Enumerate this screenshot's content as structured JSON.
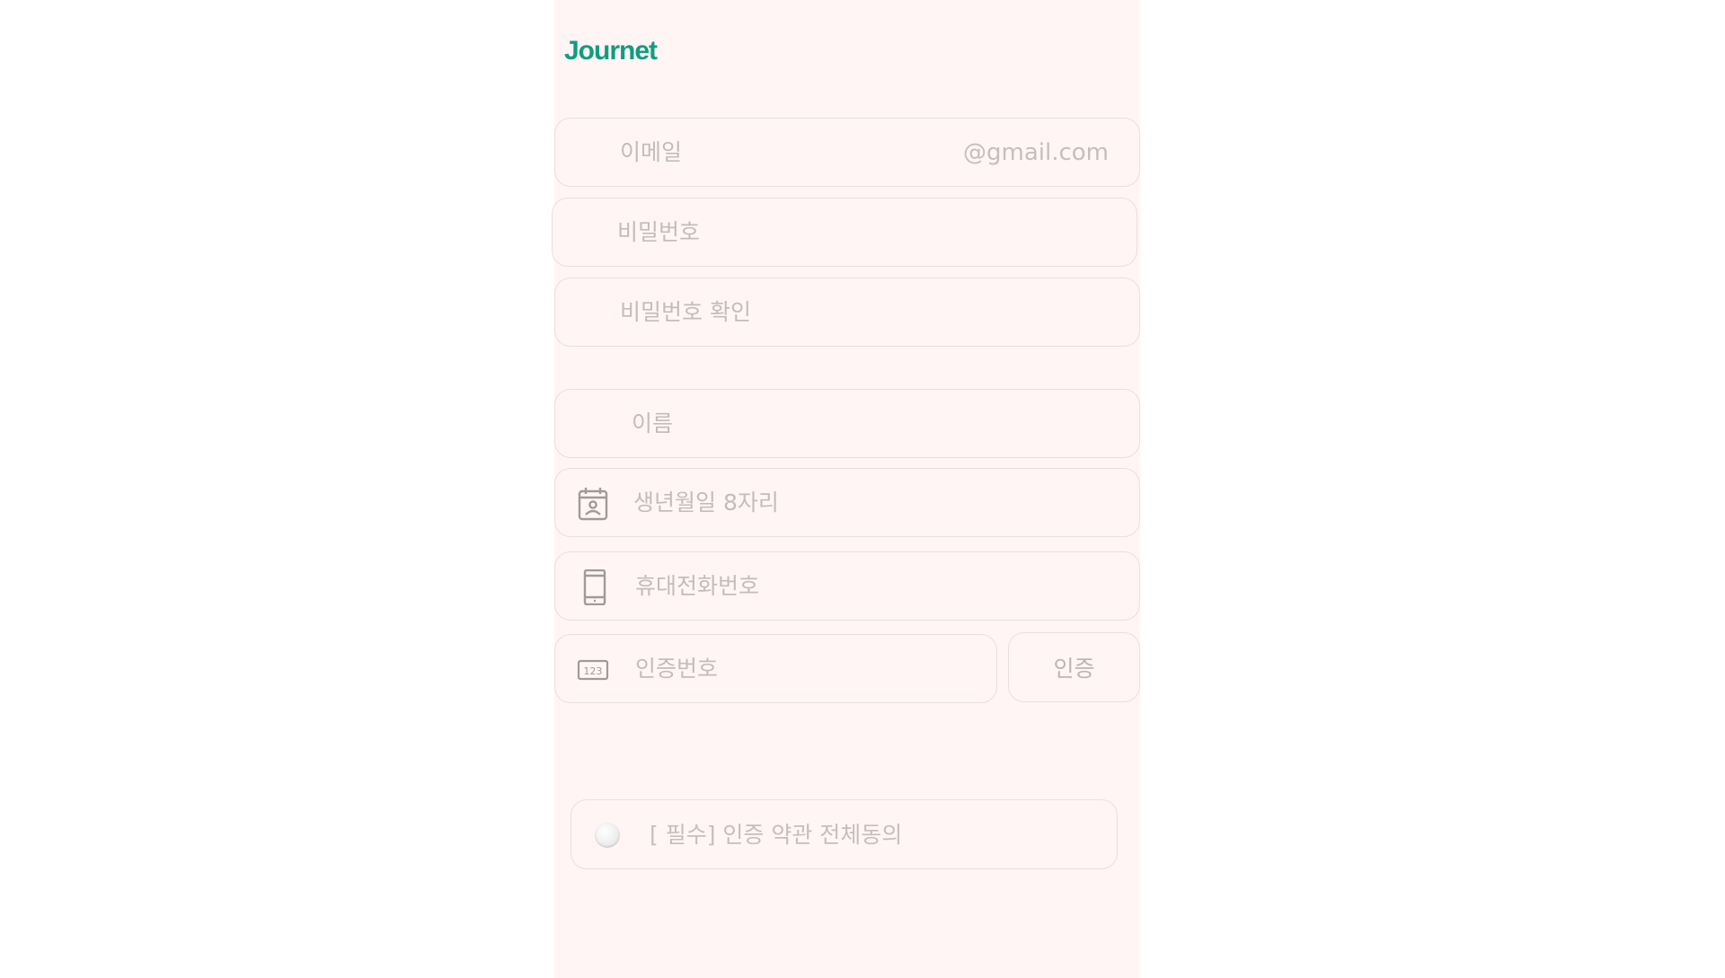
{
  "app": {
    "logo": "Journet",
    "brand_color": "#119d7f"
  },
  "form": {
    "email": {
      "placeholder": "이메일",
      "suffix": "@gmail.com"
    },
    "password": {
      "placeholder": "비밀번호"
    },
    "password_confirm": {
      "placeholder": "비밀번호 확인"
    },
    "name": {
      "placeholder": "이름"
    },
    "birthdate": {
      "placeholder": "생년월일 8자리",
      "icon": "calendar-person-icon"
    },
    "phone": {
      "placeholder": "휴대전화번호",
      "icon": "mobile-phone-icon"
    },
    "verification_code": {
      "placeholder": "인증번호",
      "icon": "numbers-123-icon"
    },
    "verify_button_label": "인증",
    "terms": {
      "label": "[ 필수] 인증 약관 전체동의",
      "checked": false
    }
  }
}
